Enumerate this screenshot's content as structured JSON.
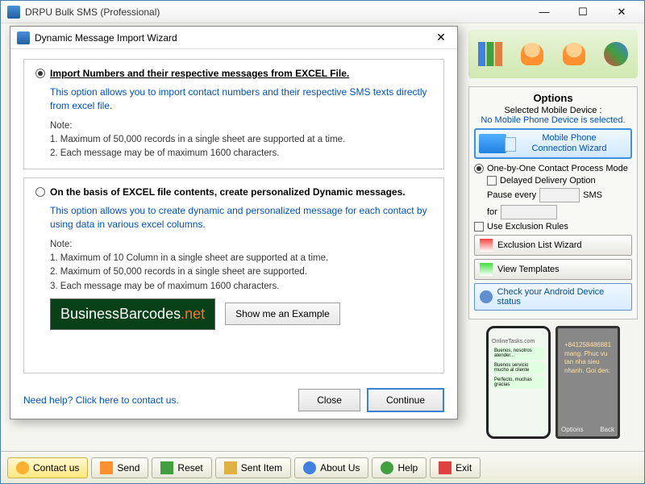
{
  "main_window": {
    "title": "DRPU Bulk SMS (Professional)"
  },
  "dialog": {
    "title": "Dynamic Message Import Wizard",
    "option1": {
      "label": "Import Numbers and their respective messages from EXCEL File.",
      "desc": "This option allows you to import contact numbers and their respective SMS texts directly from excel file.",
      "note_label": "Note:",
      "note1": "1. Maximum of 50,000 records in a single sheet are supported at a time.",
      "note2": "2. Each message may be of maximum 1600 characters."
    },
    "option2": {
      "label": "On the basis of EXCEL file contents, create personalized Dynamic messages.",
      "desc": "This option allows you to create dynamic and personalized message for each contact by using data in various excel columns.",
      "note_label": "Note:",
      "note1": "1. Maximum of 10 Column in a single sheet are supported at a time.",
      "note2": "2. Maximum of 50,000 records in a single sheet are supported.",
      "note3": "3. Each message may be of maximum 1600 characters."
    },
    "banner_text": "BusinessBarcodes",
    "banner_suffix": ".net",
    "example_btn": "Show me an Example",
    "help_link": "Need help? Click here to contact us.",
    "close_btn": "Close",
    "continue_btn": "Continue"
  },
  "options": {
    "title": "Options",
    "selected_label": "Selected Mobile Device :",
    "selected_status": "No Mobile Phone Device is selected.",
    "conn_wizard_line1": "Mobile Phone",
    "conn_wizard_line2": "Connection  Wizard",
    "mode_label": "One-by-One Contact Process Mode",
    "delayed_label": "Delayed Delivery Option",
    "pause_label": "Pause every",
    "sms_label": "SMS",
    "for_label": "for",
    "exclusion_label": "Use Exclusion Rules",
    "exclusion_btn": "Exclusion List Wizard",
    "templates_btn": "View Templates",
    "android_btn": "Check your Android Device status"
  },
  "phone1": {
    "header": "OnlineTasks.com",
    "msg1": "Buenos, nosotros atender...",
    "msg2": "Buenos servicio mucho al cliente",
    "msg3": "Perfecto, muchas gracias"
  },
  "phone2": {
    "number": "+841258486881",
    "text": "mang. Phuc vu tan nha sieu nhanh. Goi den:",
    "left": "Options",
    "right": "Back"
  },
  "toolbar": {
    "contact": "Contact us",
    "send": "Send",
    "reset": "Reset",
    "sent_item": "Sent Item",
    "about": "About Us",
    "help": "Help",
    "exit": "Exit"
  }
}
